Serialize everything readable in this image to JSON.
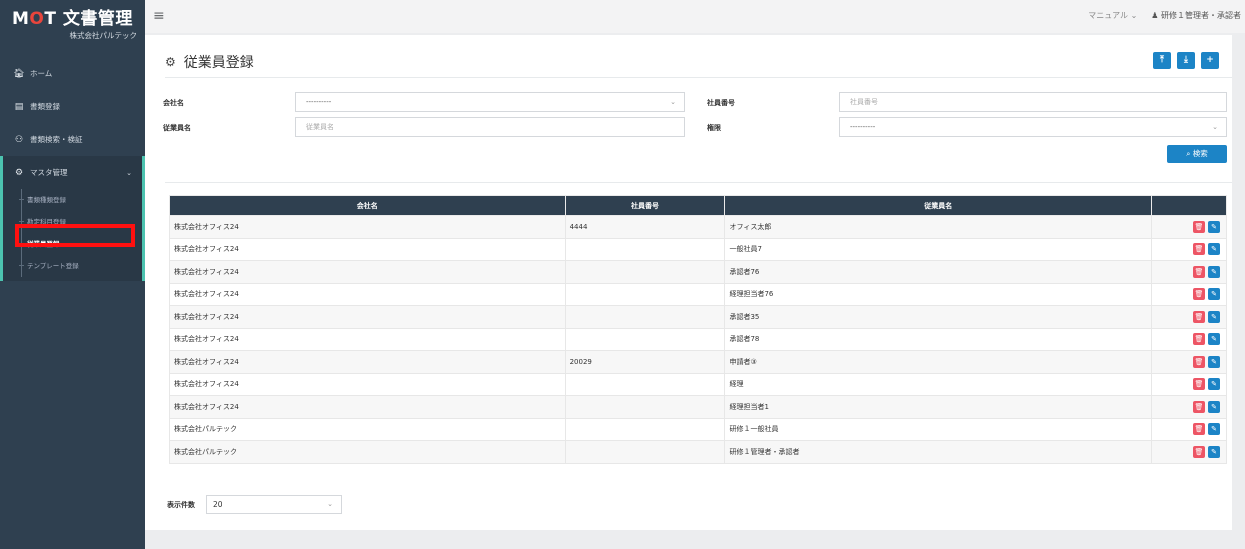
{
  "sidebar": {
    "logo_prefix": "M",
    "logo_o": "O",
    "logo_rest": "T 文書管理",
    "company": "株式会社パルテック",
    "items": [
      {
        "icon": "home-icon",
        "label": "ホーム"
      },
      {
        "icon": "document-icon",
        "label": "書類登録"
      },
      {
        "icon": "search-verify-icon",
        "label": "書類検索・検証"
      }
    ],
    "group": {
      "label": "マスタ管理",
      "children": [
        "書類種類登録",
        "勘定科目登録",
        "従業員登録",
        "テンプレート登録"
      ]
    }
  },
  "topbar": {
    "manual": "マニュアル ⌄",
    "user": "研修１管理者・承認者"
  },
  "page": {
    "title": "従業員登録"
  },
  "form": {
    "company_label": "会社名",
    "company_value": "----------",
    "employee_no_label": "社員番号",
    "employee_no_placeholder": "社員番号",
    "employee_name_label": "従業員名",
    "employee_name_placeholder": "従業員名",
    "role_label": "権限",
    "role_value": "----------",
    "search_button": "検索"
  },
  "table": {
    "headers": [
      "会社名",
      "社員番号",
      "従業員名",
      ""
    ],
    "rows": [
      [
        "株式会社オフィス24",
        "4444",
        "オフィス太郎"
      ],
      [
        "株式会社オフィス24",
        "",
        "一般社員7"
      ],
      [
        "株式会社オフィス24",
        "",
        "承認者76"
      ],
      [
        "株式会社オフィス24",
        "",
        "経理担当者76"
      ],
      [
        "株式会社オフィス24",
        "",
        "承認者35"
      ],
      [
        "株式会社オフィス24",
        "",
        "承認者78"
      ],
      [
        "株式会社オフィス24",
        "20029",
        "申請者③"
      ],
      [
        "株式会社オフィス24",
        "",
        "経理"
      ],
      [
        "株式会社オフィス24",
        "",
        "経理担当者1"
      ],
      [
        "株式会社パルテック",
        "",
        "研修１一般社員"
      ],
      [
        "株式会社パルテック",
        "",
        "研修１管理者・承認者"
      ]
    ]
  },
  "pager": {
    "label": "表示件数",
    "value": "20"
  },
  "colors": {
    "sidebar_bg": "#2f4050",
    "accent": "#1c84c6",
    "danger": "#ed5565",
    "highlight": "#ff1010"
  }
}
